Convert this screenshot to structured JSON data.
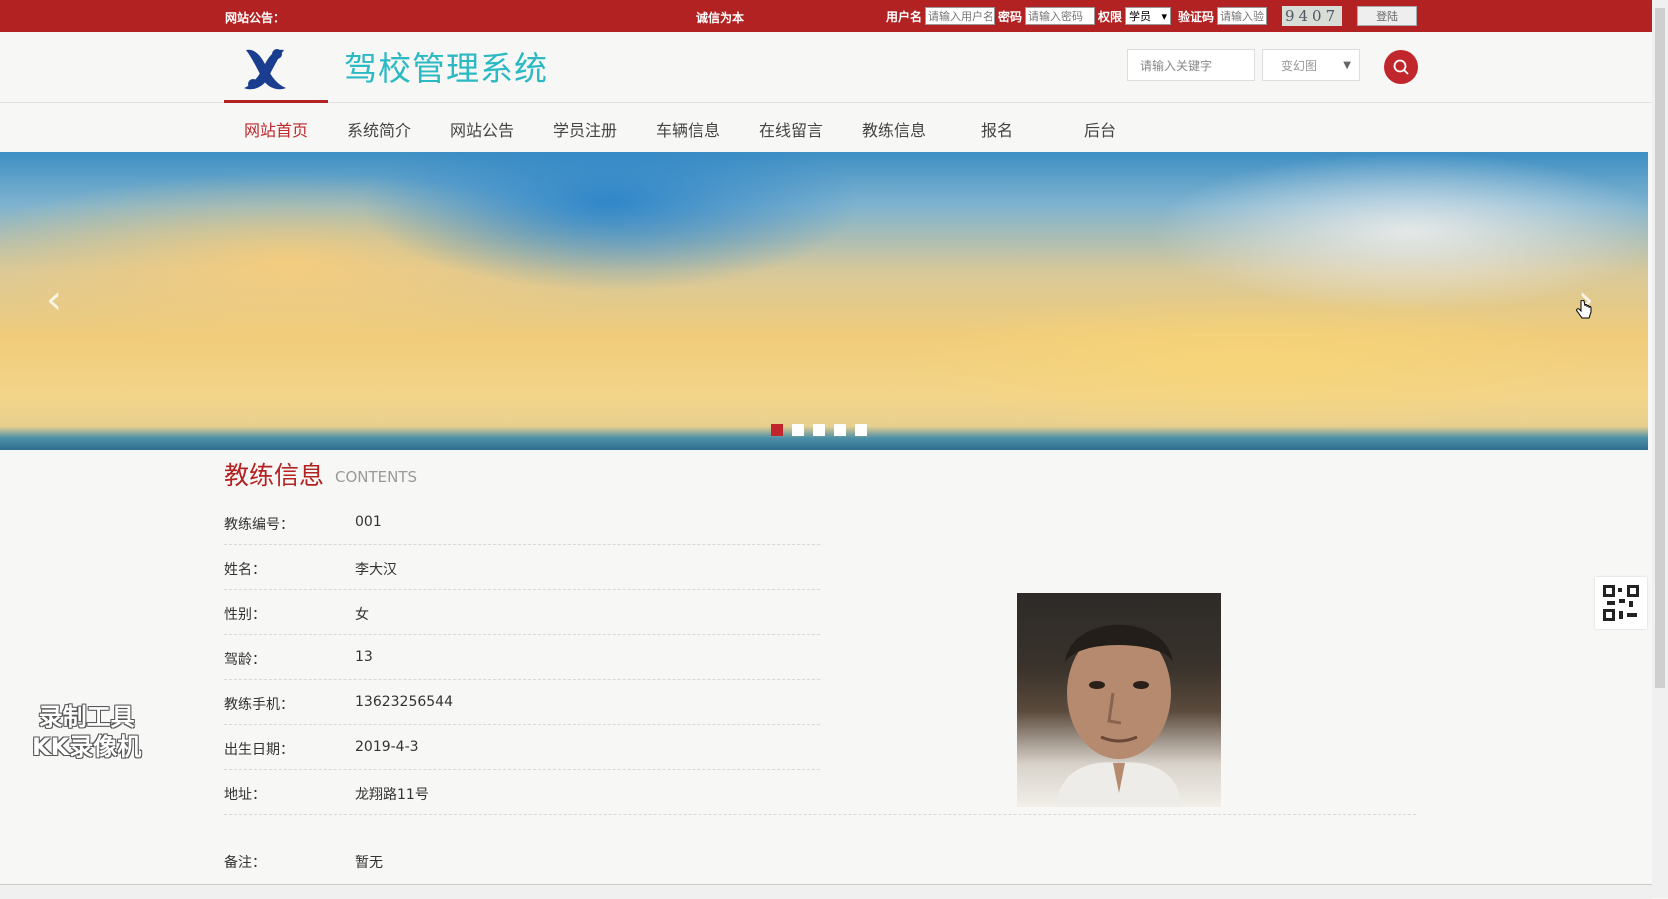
{
  "topbar": {
    "announcement_label": "网站公告：",
    "marquee": "诚信为本",
    "username_label": "用户名",
    "username_placeholder": "请输入用户名",
    "password_label": "密码",
    "password_placeholder": "请输入密码",
    "role_label": "权限",
    "role_value": "学员",
    "captcha_label": "验证码",
    "captcha_placeholder": "请输入验",
    "captcha_code": "9407",
    "login_button": "登陆"
  },
  "header": {
    "title": "驾校管理系统",
    "search_placeholder": "请输入关键字",
    "search_select": "变幻图"
  },
  "nav": {
    "items": [
      "网站首页",
      "系统简介",
      "网站公告",
      "学员注册",
      "车辆信息",
      "在线留言",
      "教练信息",
      "报名",
      "后台"
    ],
    "active_index": 0
  },
  "banner": {
    "prev": "‹",
    "next": "›",
    "slide_count": 5,
    "active_slide": 1
  },
  "contents": {
    "title": "教练信息",
    "subtitle": "CONTENTS",
    "fields": [
      {
        "label": "教练编号：",
        "value": "001"
      },
      {
        "label": "姓名：",
        "value": "李大汉"
      },
      {
        "label": "性别：",
        "value": "女"
      },
      {
        "label": "驾龄：",
        "value": "13"
      },
      {
        "label": "教练手机：",
        "value": "13623256544"
      },
      {
        "label": "出生日期：",
        "value": "2019-4-3"
      },
      {
        "label": "地址：",
        "value": "龙翔路11号"
      }
    ],
    "note_label": "备注：",
    "note_value": "暂无"
  },
  "watermark": {
    "line1": "录制工具",
    "line2": "KK录像机"
  },
  "colors": {
    "brand_red": "#b22222",
    "title_cyan": "#2bb9c4",
    "accent_red": "#c0262b"
  }
}
